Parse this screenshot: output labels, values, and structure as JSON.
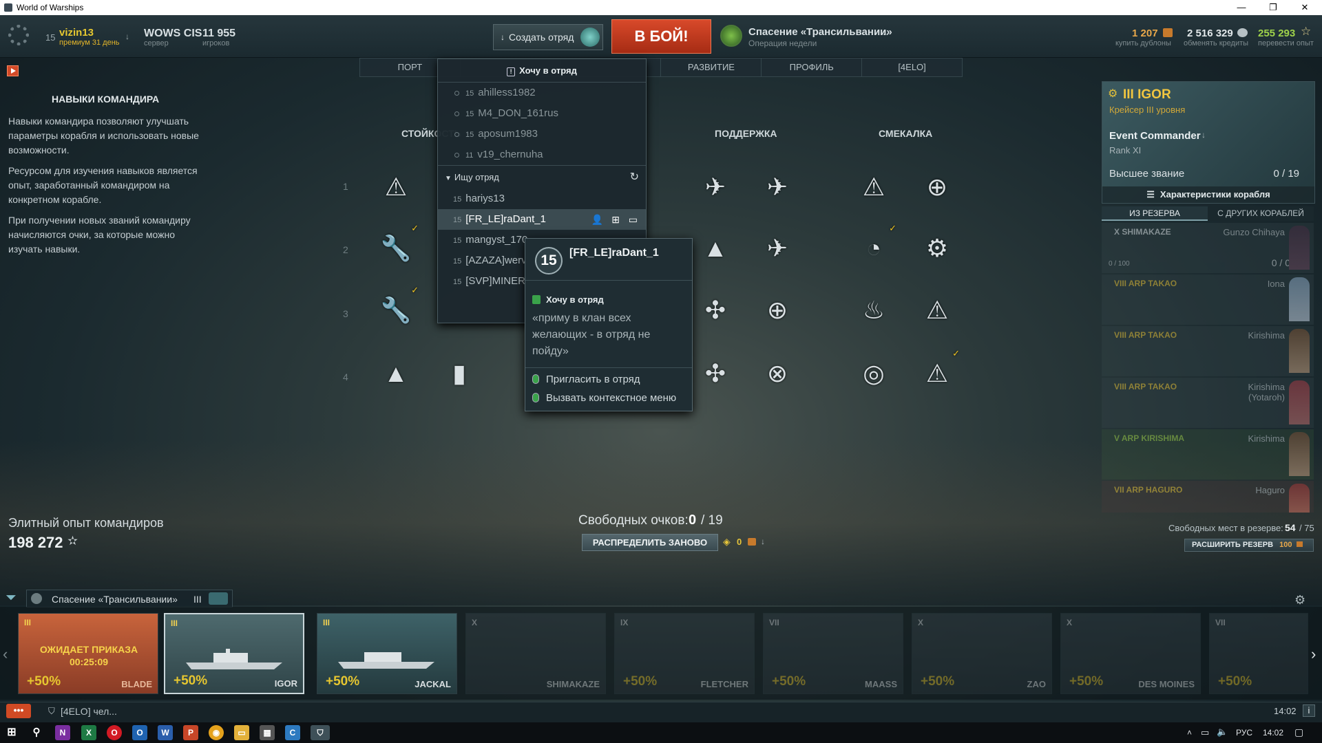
{
  "window": {
    "title": "World of Warships",
    "minimize": "—",
    "maximize": "❐",
    "close": "✕"
  },
  "player": {
    "level": "15",
    "name": "vizin13",
    "premium": "премиум 31 день"
  },
  "server": {
    "name": "WOWS CIS",
    "label": "сервер"
  },
  "online": {
    "count": "11 955",
    "label": "игроков"
  },
  "create_squad": "Создать отряд",
  "battle_button": "В БОЙ!",
  "mode": {
    "title": "Спасение «Трансильвании»",
    "subtitle": "Операция недели",
    "more": "..."
  },
  "currency": {
    "doubloons": {
      "value": "1 207",
      "label": "купить дублоны"
    },
    "credits": {
      "value": "2 516 329",
      "label": "обменять кредиты"
    },
    "free_xp": {
      "value": "255 293",
      "label": "перевести опыт"
    }
  },
  "nav_tabs": [
    "ПОРТ",
    "",
    "",
    "РАЗВИТИЕ",
    "ПРОФИЛЬ",
    "[4ELO]"
  ],
  "left": {
    "title": "НАВЫКИ КОМАНДИРА",
    "p1": "Навыки командира позволяют улучшать параметры корабля и использовать новые возможности.",
    "p2": "Ресурсом для изучения навыков является опыт, заработанный командиром на конкретном корабле.",
    "p3": "При получении новых званий командиру начисляются очки, за которые можно изучать навыки.",
    "elite_label": "Элитный опыт командиров",
    "elite_value": "198 272"
  },
  "skills": {
    "columns": [
      "СТОЙКОСТЬ",
      "",
      "ПОДДЕРЖКА",
      "СМЕКАЛКА"
    ],
    "rows": [
      "1",
      "2",
      "3",
      "4"
    ]
  },
  "free_points": {
    "label": "Свободных очков:",
    "value": "0",
    "total": "/ 19"
  },
  "redistribute": "РАСПРЕДЕЛИТЬ ЗАНОВО",
  "redistribute_cost": "0",
  "squad_panel": {
    "header": "Хочу в отряд",
    "members": [
      {
        "lv": "15",
        "name": "ahilless1982"
      },
      {
        "lv": "15",
        "name": "M4_DON_161rus"
      },
      {
        "lv": "15",
        "name": "aposum1983"
      },
      {
        "lv": "11",
        "name": "v19_chernuha"
      }
    ],
    "seeking_header": "Ищу отряд",
    "seeking": [
      {
        "lv": "15",
        "name": "hariys13"
      },
      {
        "lv": "15",
        "name": "[FR_LE]raDant_1"
      },
      {
        "lv": "15",
        "name": "mangyst_170..."
      },
      {
        "lv": "15",
        "name": "[AZAZA]werv..."
      },
      {
        "lv": "15",
        "name": "[SVP]MINER..."
      }
    ]
  },
  "tooltip": {
    "level": "15",
    "name": "[FR_LE]raDant_1",
    "status": "Хочу в отряд",
    "quote": "«приму в клан всех желающих - в отряд не пойду»",
    "action_invite": "Пригласить в отряд",
    "action_menu": "Вызвать контекстное меню"
  },
  "commander": {
    "name": "III IGOR",
    "type": "Крейсер III уровня",
    "title": "Event Commander",
    "rank": "Rank XI",
    "highest_label": "Высшее звание",
    "points": "0 / 19",
    "ship_specs": "Характеристики корабля"
  },
  "reserve_tabs": [
    "ИЗ РЕЗЕРВА",
    "С ДРУГИХ КОРАБЛЕЙ"
  ],
  "reserve": [
    {
      "ship": "X SHIMAKAZE",
      "cmd": "Gunzo Chihaya",
      "extra": "0 / 0",
      "xp": "0 / 100"
    },
    {
      "ship": "VIII ARP TAKAO",
      "cmd": "Iona",
      "extra": "",
      "xp": ""
    },
    {
      "ship": "VIII ARP TAKAO",
      "cmd": "Kirishima",
      "extra": "",
      "xp": ""
    },
    {
      "ship": "VIII ARP TAKAO",
      "cmd": "Kirishima (Yotaroh)",
      "extra": "",
      "xp": ""
    },
    {
      "ship": "V ARP KIRISHIMA",
      "cmd": "Kirishima",
      "extra": "",
      "xp": ""
    },
    {
      "ship": "VII ARP HAGURO",
      "cmd": "Haguro",
      "extra": "",
      "xp": ""
    }
  ],
  "reserve_slots": {
    "label": "Свободных мест в резерве:",
    "value": "54",
    "total": "/ 75"
  },
  "expand_reserve": {
    "label": "РАСШИРИТЬ РЕЗЕРВ",
    "cost": "100"
  },
  "filter": {
    "mode": "Спасение «Трансильвании»",
    "tier": "III"
  },
  "ships": [
    {
      "tier": "III",
      "name": "BLADE",
      "bonus": "+50%",
      "overlay": "ОЖИДАЕТ ПРИКАЗА",
      "timer": "00:25:09"
    },
    {
      "tier": "III",
      "name": "IGOR",
      "bonus": "+50%"
    },
    {
      "tier": "III",
      "name": "JACKAL",
      "bonus": "+50%"
    },
    {
      "tier": "X",
      "name": "SHIMAKAZE",
      "bonus": ""
    },
    {
      "tier": "IX",
      "name": "FLETCHER",
      "bonus": "+50%"
    },
    {
      "tier": "VII",
      "name": "MAASS",
      "bonus": "+50%"
    },
    {
      "tier": "X",
      "name": "ZAO",
      "bonus": "+50%"
    },
    {
      "tier": "X",
      "name": "DES MOINES",
      "bonus": "+50%"
    },
    {
      "tier": "VII",
      "name": "",
      "bonus": "+50%"
    }
  ],
  "chat": {
    "menu": "•••",
    "channel": "[4ELO] чел..."
  },
  "clock": "14:02",
  "taskbar": {
    "lang": "РУС",
    "time": "14:02"
  }
}
